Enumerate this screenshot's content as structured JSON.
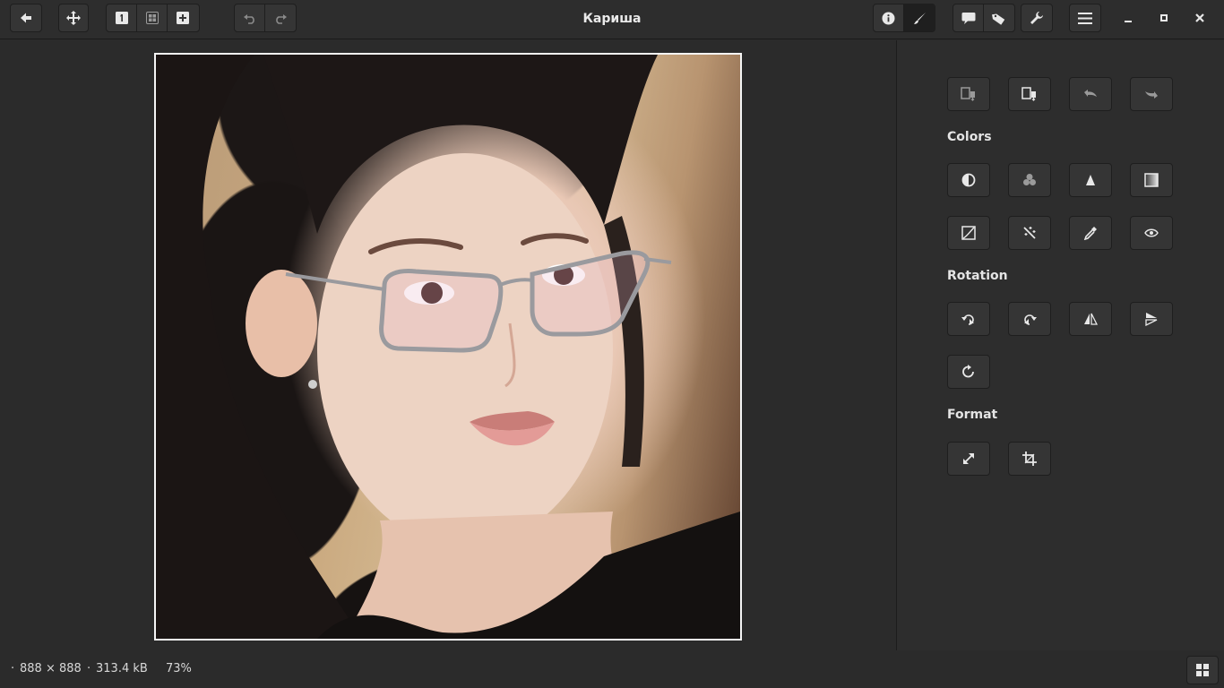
{
  "window": {
    "title": "Кариша"
  },
  "panel": {
    "sections": {
      "colors": "Colors",
      "rotation": "Rotation",
      "format": "Format"
    }
  },
  "status": {
    "dimensions": "888 × 888",
    "size": "313.4 kB",
    "zoom": "73%"
  },
  "colors": {
    "accent_bg": "#2d2d2d",
    "button_bg": "#353535",
    "text": "#e6e6e6"
  }
}
